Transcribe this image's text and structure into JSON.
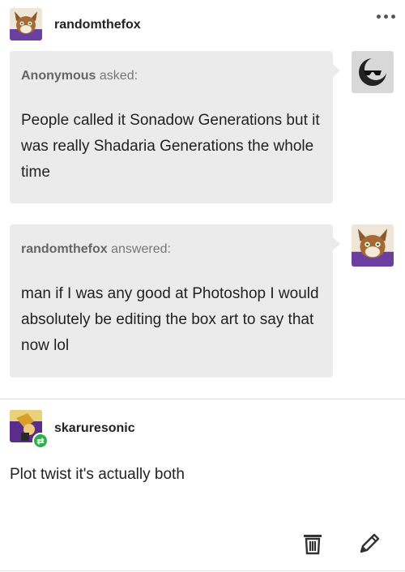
{
  "post": {
    "author": "randomthefox",
    "more_icon": "more-dots-icon"
  },
  "ask": {
    "asker": "Anonymous",
    "asked_word": "asked:",
    "text": "People called it Sonadow Generations but it was really Shadaria Generations the whole time"
  },
  "answer": {
    "author": "randomthefox",
    "answered_word": "answered:",
    "text": "man if I was any good at Photoshop I would absolutely be editing the box art to say that now lol"
  },
  "reblog": {
    "author": "skaruresonic",
    "comment": "Plot twist it's actually both",
    "badge_icon": "reblog-icon"
  },
  "actions": {
    "delete_icon": "trash-icon",
    "edit_icon": "pencil-icon"
  },
  "colors": {
    "bubble": "#ebebeb",
    "reblog_badge": "#2bb24c",
    "fox_purple": "#6a3fa0",
    "fox_brown": "#8a5a2b"
  }
}
